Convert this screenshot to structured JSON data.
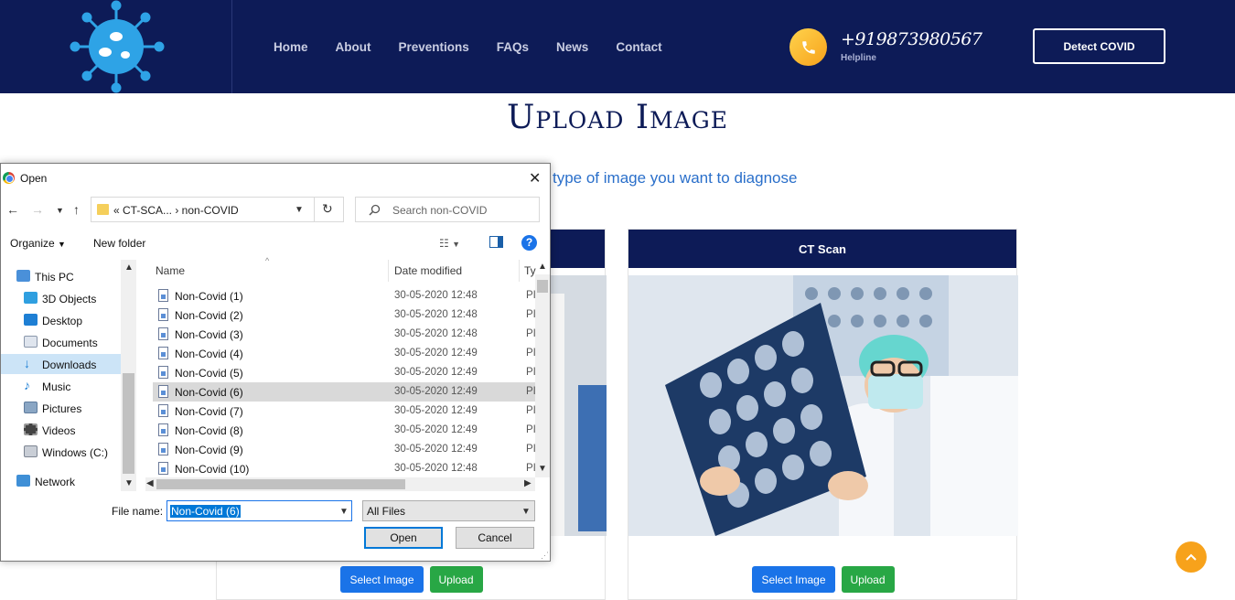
{
  "header": {
    "nav": [
      "Home",
      "About",
      "Preventions",
      "FAQs",
      "News",
      "Contact"
    ],
    "phone": "+919873980567",
    "phone_label": "Helpline",
    "cta": "Detect COVID"
  },
  "page": {
    "title": "Upload Image",
    "subtitle": "type of image you want to diagnose",
    "cards": [
      {
        "title": "",
        "select_label": "Select Image",
        "upload_label": "Upload"
      },
      {
        "title": "CT Scan",
        "select_label": "Select Image",
        "upload_label": "Upload"
      }
    ]
  },
  "dialog": {
    "title": "Open",
    "address": "«  CT-SCA...  ›   non-COVID",
    "search_placeholder": "Search non-COVID",
    "organize": "Organize",
    "new_folder": "New folder",
    "sidebar": [
      "This PC",
      "3D Objects",
      "Desktop",
      "Documents",
      "Downloads",
      "Music",
      "Pictures",
      "Videos",
      "Windows (C:)",
      "Network"
    ],
    "selected_sidebar": "Downloads",
    "columns": [
      "Name",
      "Date modified",
      "Ty"
    ],
    "files": [
      {
        "name": "Non-Covid (1)",
        "date": "30-05-2020 12:48",
        "type": "PI"
      },
      {
        "name": "Non-Covid (2)",
        "date": "30-05-2020 12:48",
        "type": "PI"
      },
      {
        "name": "Non-Covid (3)",
        "date": "30-05-2020 12:48",
        "type": "PI"
      },
      {
        "name": "Non-Covid (4)",
        "date": "30-05-2020 12:49",
        "type": "PI"
      },
      {
        "name": "Non-Covid (5)",
        "date": "30-05-2020 12:49",
        "type": "PI"
      },
      {
        "name": "Non-Covid (6)",
        "date": "30-05-2020 12:49",
        "type": "PI"
      },
      {
        "name": "Non-Covid (7)",
        "date": "30-05-2020 12:49",
        "type": "PI"
      },
      {
        "name": "Non-Covid (8)",
        "date": "30-05-2020 12:49",
        "type": "PI"
      },
      {
        "name": "Non-Covid (9)",
        "date": "30-05-2020 12:49",
        "type": "PI"
      },
      {
        "name": "Non-Covid (10)",
        "date": "30-05-2020 12:48",
        "type": "PI"
      }
    ],
    "selected_file": "Non-Covid (6)",
    "filename_label": "File name:",
    "filename_value": "Non-Covid (6)",
    "filter_value": "All Files",
    "open_label": "Open",
    "cancel_label": "Cancel"
  }
}
